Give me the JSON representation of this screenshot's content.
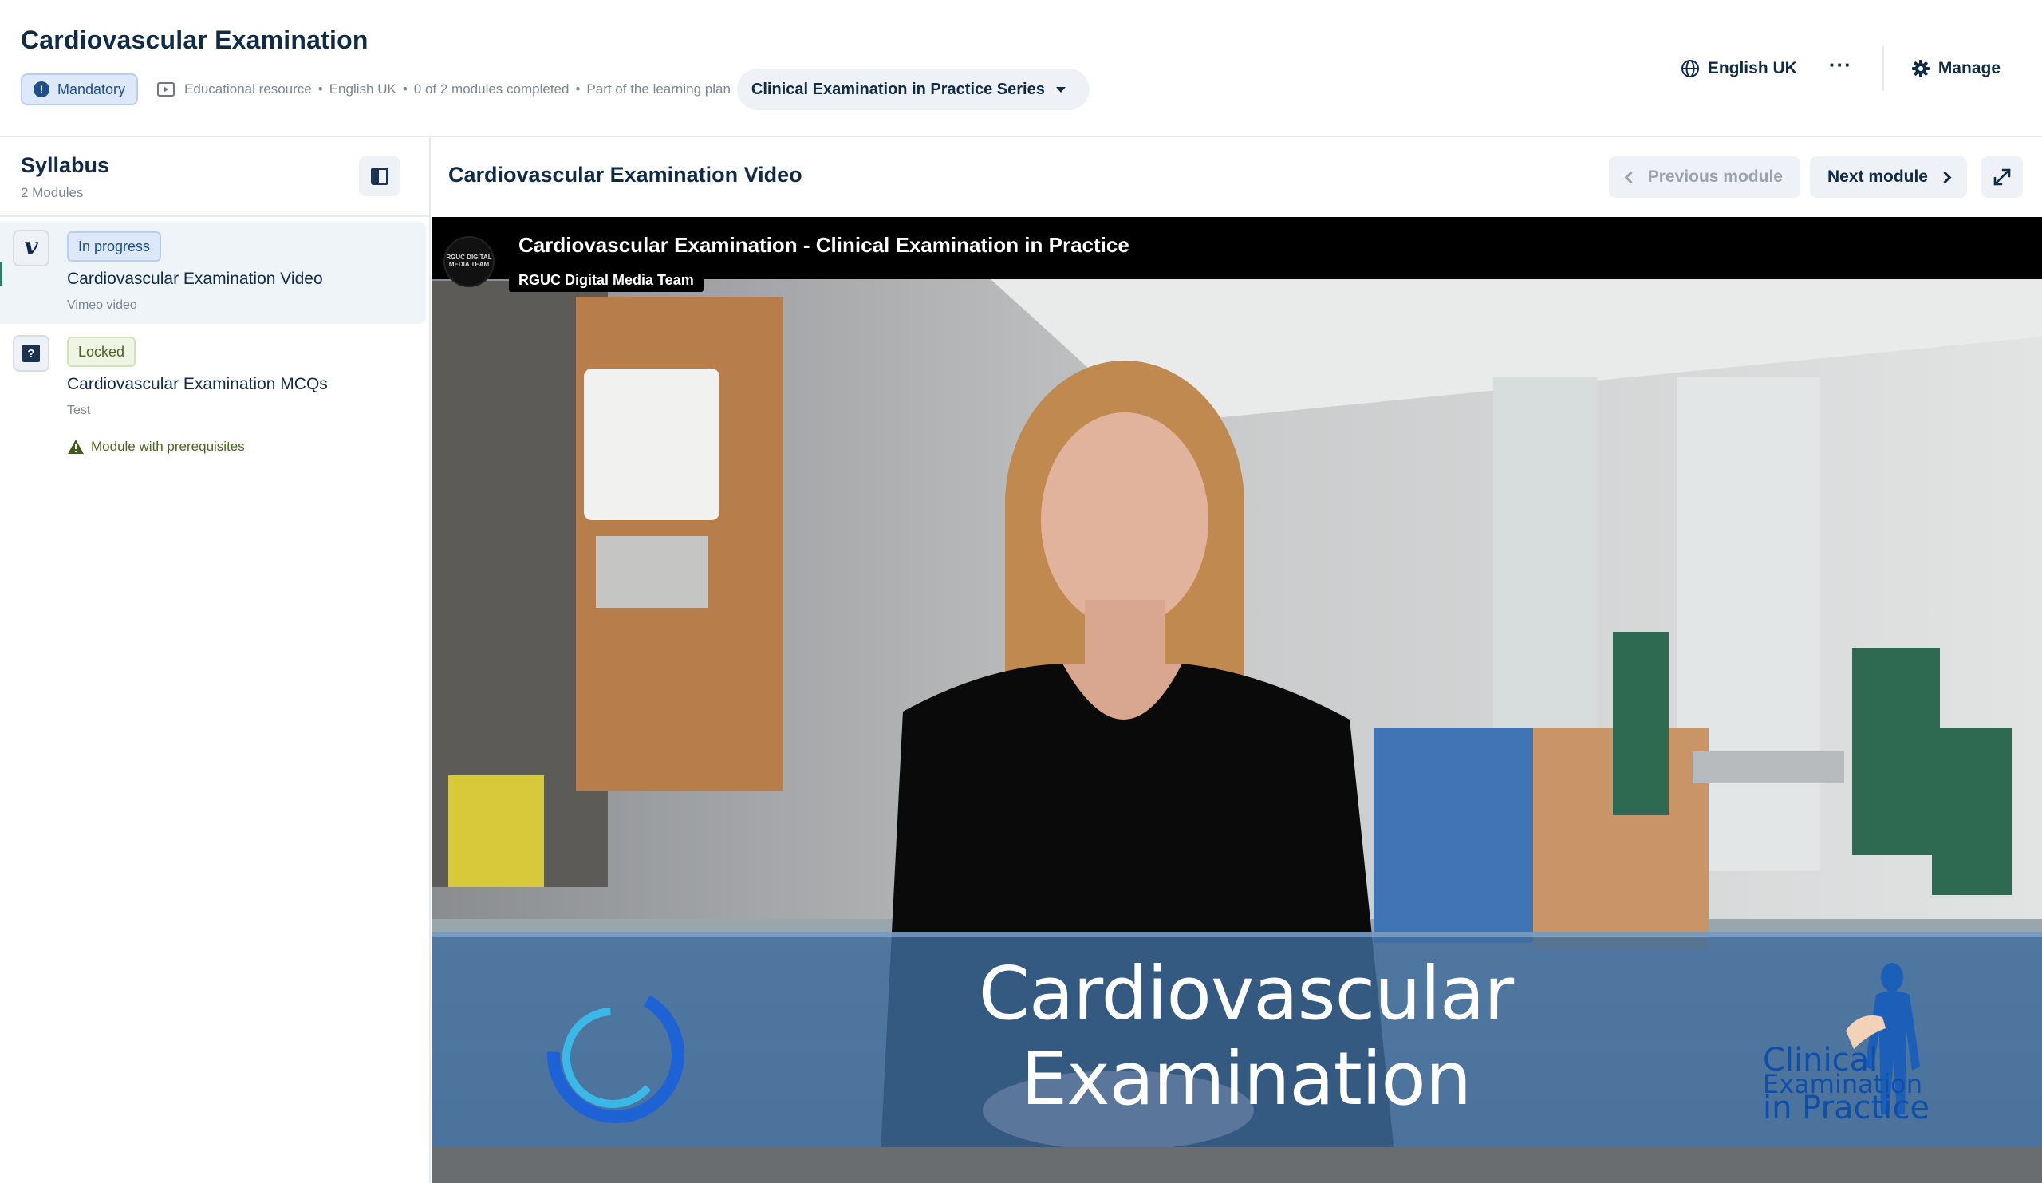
{
  "header": {
    "title": "Cardiovascular Examination",
    "badge": "Mandatory",
    "meta": {
      "type": "Educational resource",
      "language": "English UK",
      "progress": "0 of 2 modules completed",
      "plan_prefix": "Part of the learning plan"
    },
    "plan_name": "Clinical Examination in Practice Series",
    "language_label": "English UK",
    "more_label": "···",
    "manage_label": "Manage"
  },
  "sidebar": {
    "title": "Syllabus",
    "count": "2 Modules",
    "modules": [
      {
        "status": "In progress",
        "title": "Cardiovascular Examination Video",
        "subtitle": "Vimeo video",
        "icon": "vimeo-icon"
      },
      {
        "status": "Locked",
        "title": "Cardiovascular Examination MCQs",
        "subtitle": "Test",
        "icon": "quiz-icon",
        "note": "Module with prerequisites"
      }
    ]
  },
  "main": {
    "title": "Cardiovascular Examination Video",
    "prev_label": "Previous module",
    "next_label": "Next module"
  },
  "video": {
    "title": "Cardiovascular Examination - Clinical Examination in Practice",
    "channel": "RGUC Digital Media Team",
    "avatar_text": "RGUC DIGITAL MEDIA TEAM",
    "lower_third": "Cardiovascular Examination",
    "logo_line1": "Clinical",
    "logo_line2": "Examination",
    "logo_line3": "in Practice"
  },
  "colors": {
    "primary_text": "#0f2b46",
    "muted_text": "#7a8592",
    "badge_blue_bg": "#dde9f8",
    "badge_locked_bg": "#eef5e2",
    "button_bg": "#eef1f5"
  }
}
